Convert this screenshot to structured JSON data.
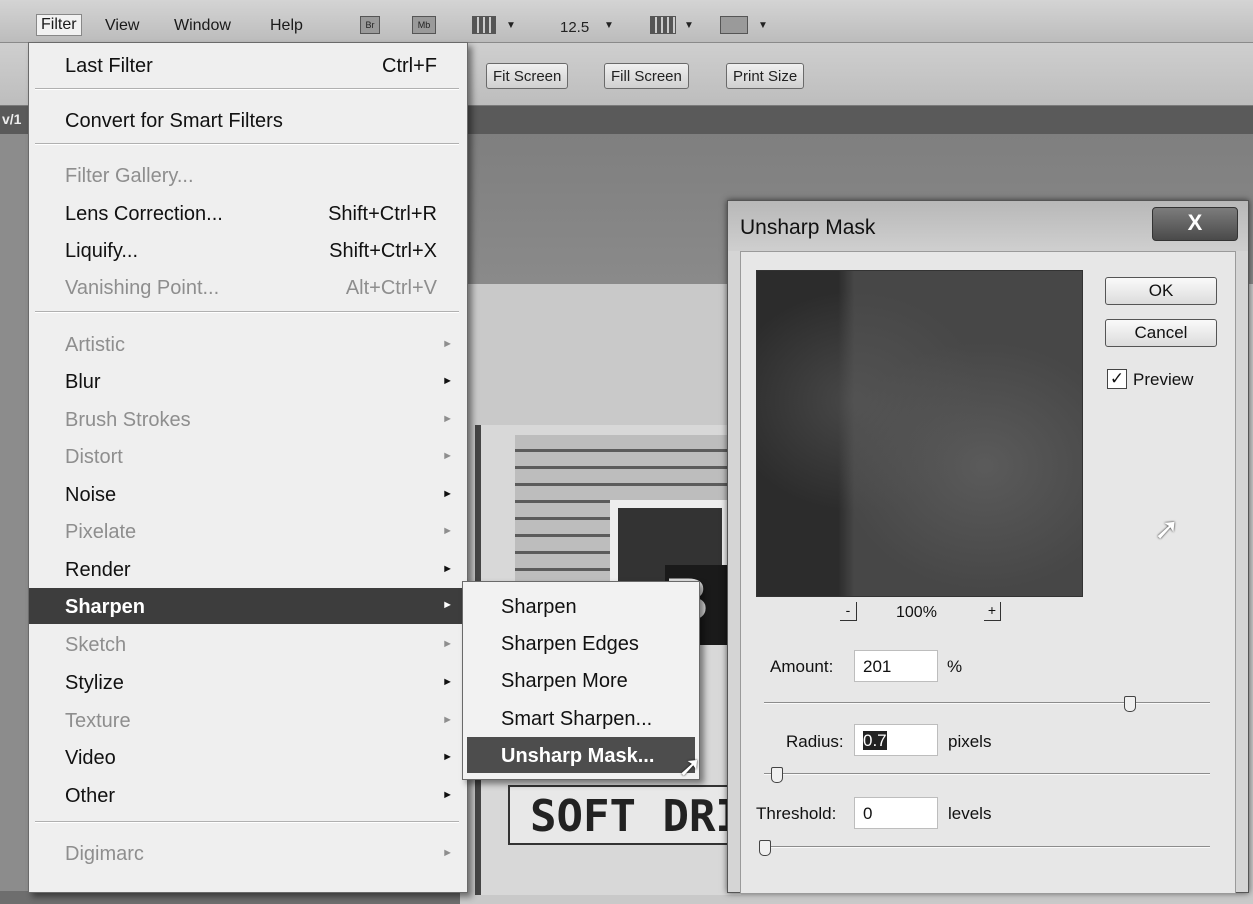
{
  "menubar": {
    "filter": "Filter",
    "view": "View",
    "window": "Window",
    "help": "Help",
    "br": "Br",
    "mb": "Mb",
    "zoom": "12.5"
  },
  "options": {
    "fit_screen": "Fit Screen",
    "fill_screen": "Fill Screen",
    "print_size": "Print Size"
  },
  "document": {
    "tab_text": "v/1"
  },
  "canvas_sign": {
    "sign_text": "SOFT DRIN",
    "b_text": "B"
  },
  "filter_menu": {
    "last_filter": {
      "label": "Last Filter",
      "shortcut": "Ctrl+F"
    },
    "convert": "Convert for Smart Filters",
    "filter_gallery": "Filter Gallery...",
    "lens_correction": {
      "label": "Lens Correction...",
      "shortcut": "Shift+Ctrl+R"
    },
    "liquify": {
      "label": "Liquify...",
      "shortcut": "Shift+Ctrl+X"
    },
    "vanishing_point": {
      "label": "Vanishing Point...",
      "shortcut": "Alt+Ctrl+V"
    },
    "groups": [
      "Artistic",
      "Blur",
      "Brush Strokes",
      "Distort",
      "Noise",
      "Pixelate",
      "Render",
      "Sharpen",
      "Sketch",
      "Stylize",
      "Texture",
      "Video",
      "Other"
    ],
    "digimarc": "Digimarc"
  },
  "sharpen_submenu": [
    "Sharpen",
    "Sharpen Edges",
    "Sharpen More",
    "Smart Sharpen...",
    "Unsharp Mask..."
  ],
  "dialog": {
    "title": "Unsharp Mask",
    "close": "X",
    "ok": "OK",
    "cancel": "Cancel",
    "preview_label": "Preview",
    "preview_checked": true,
    "zoom_out": "-",
    "zoom_in": "+",
    "zoom_pct": "100%",
    "amount_label": "Amount:",
    "amount_value": "201",
    "amount_unit": "%",
    "radius_label": "Radius:",
    "radius_value": "0.7",
    "radius_unit": "pixels",
    "threshold_label": "Threshold:",
    "threshold_value": "0",
    "threshold_unit": "levels",
    "check": "✓"
  }
}
